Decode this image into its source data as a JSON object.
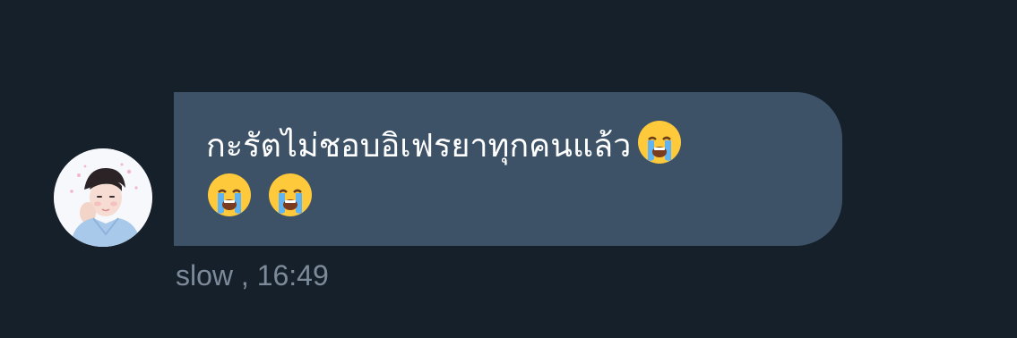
{
  "message": {
    "text": "กะรัตไม่ชอบอิเฟรยาทุกคนแล้ว",
    "emojis": [
      "loudly-crying-face-icon",
      "loudly-crying-face-icon",
      "loudly-crying-face-icon"
    ]
  },
  "meta": {
    "sender": "slow",
    "separator": " ,",
    "time": "16:49"
  },
  "colors": {
    "background": "#16202b",
    "bubble": "#3d5266",
    "text": "#ffffff",
    "meta_text": "#7c8a99"
  }
}
